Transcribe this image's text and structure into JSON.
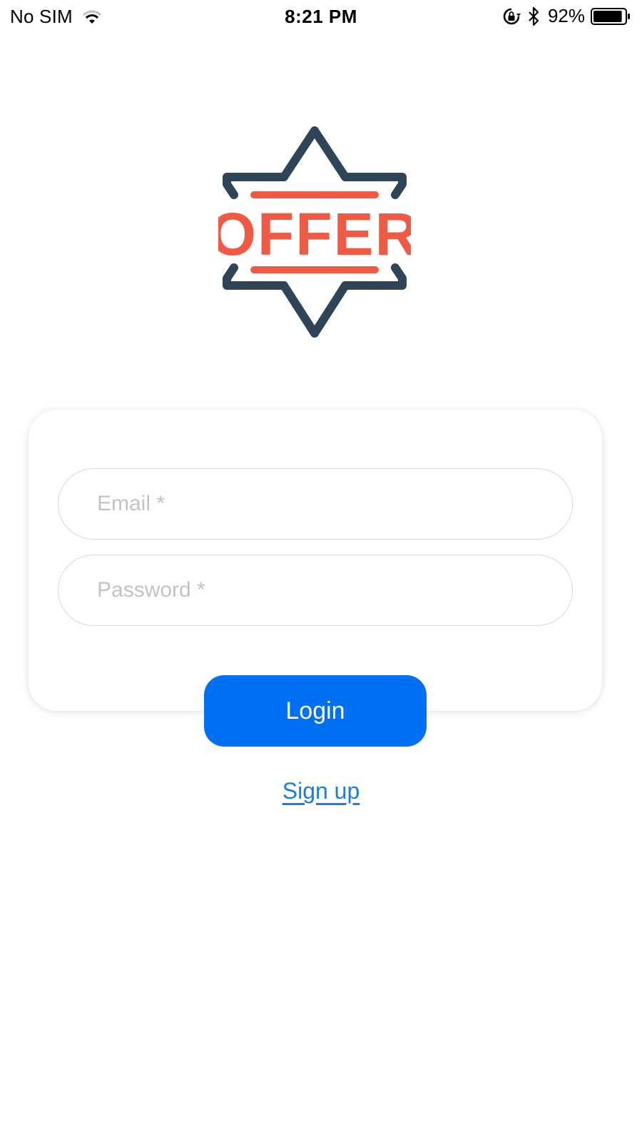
{
  "status_bar": {
    "carrier": "No SIM",
    "time": "8:21 PM",
    "battery_percent": "92%",
    "battery_level": 0.92,
    "icons": [
      "wifi-icon",
      "orientation-lock-icon",
      "bluetooth-icon",
      "battery-icon"
    ]
  },
  "logo": {
    "text": "OFFER",
    "star_color": "#2e4457",
    "text_color": "#f05a45"
  },
  "form": {
    "email_placeholder": "Email *",
    "email_value": "",
    "password_placeholder": "Password *",
    "password_value": ""
  },
  "actions": {
    "login_label": "Login",
    "signup_label": "Sign up"
  },
  "colors": {
    "accent": "#0070f2",
    "link": "#1a7de0",
    "placeholder": "#c2c2c7"
  }
}
